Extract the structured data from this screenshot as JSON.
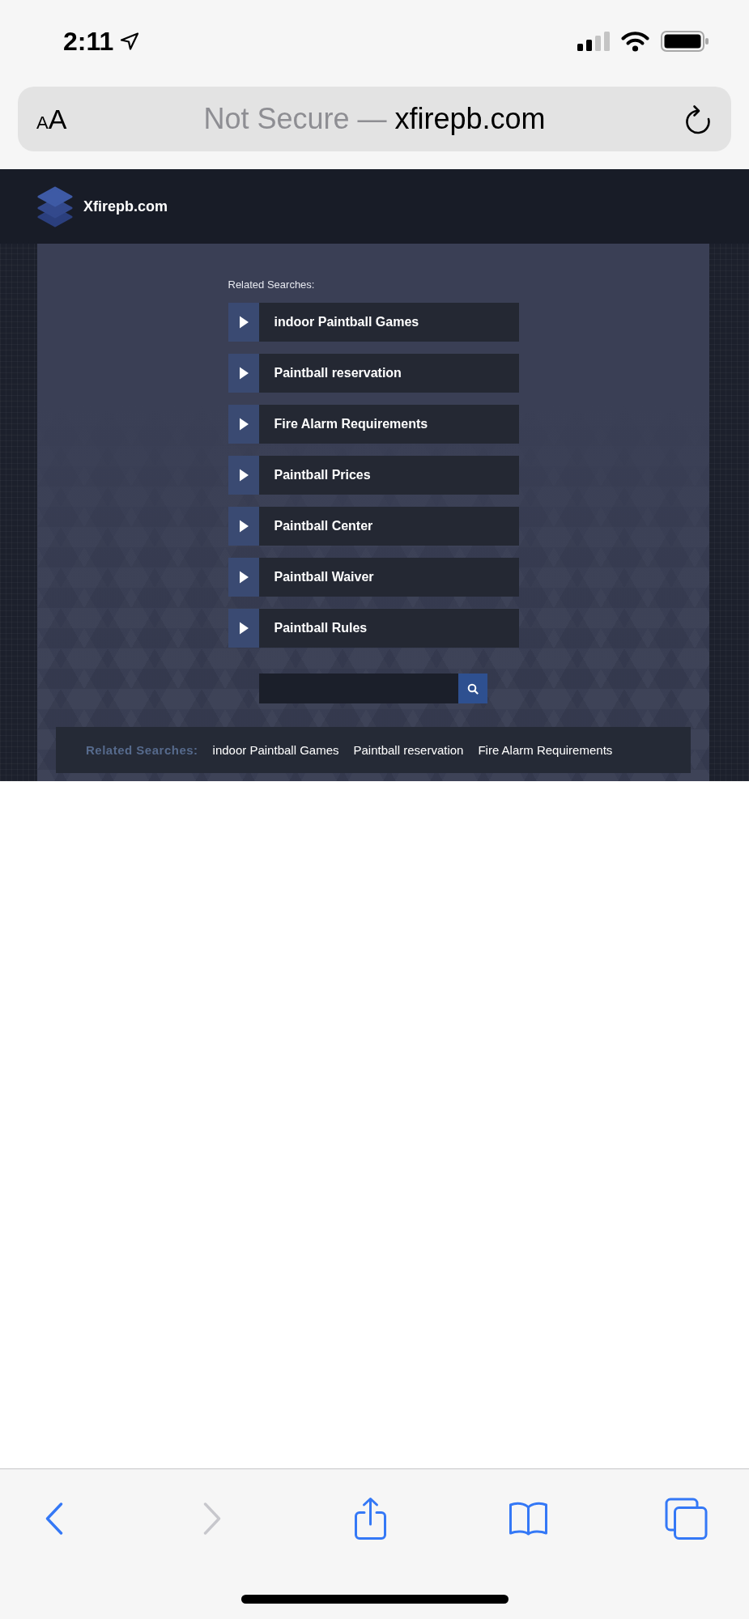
{
  "status_bar": {
    "time": "2:11"
  },
  "address_bar": {
    "text_size_button": "AA",
    "security_label": "Not Secure —",
    "domain": "xfirepb.com"
  },
  "site_header": {
    "title": "Xfirepb.com"
  },
  "related_searches": {
    "label": "Related Searches:",
    "items": [
      "indoor Paintball Games",
      "Paintball reservation",
      "Fire Alarm Requirements",
      "Paintball Prices",
      "Paintball Center",
      "Paintball Waiver",
      "Paintball Rules"
    ]
  },
  "footer": {
    "label": "Related Searches:",
    "links": [
      "indoor Paintball Games",
      "Paintball reservation",
      "Fire Alarm Requirements"
    ]
  },
  "toolbar": {
    "buttons": [
      {
        "kind": "back",
        "disabled": false
      },
      {
        "kind": "forward",
        "disabled": true
      },
      {
        "kind": "share",
        "disabled": false
      },
      {
        "kind": "bookmarks",
        "disabled": false
      },
      {
        "kind": "tabs",
        "disabled": false
      }
    ]
  }
}
